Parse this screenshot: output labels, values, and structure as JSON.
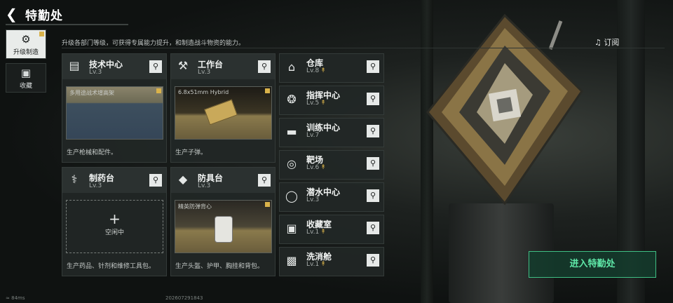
{
  "header": {
    "back_icon": "back-arrow-icon",
    "title": "特勤处"
  },
  "nav": [
    {
      "label": "升级制造",
      "icon": "upgrade-icon",
      "active": true
    },
    {
      "label": "收藏",
      "icon": "collection-icon",
      "active": false
    }
  ],
  "description": "升级各部门等级，可获得专属能力提升，和制造战斗物资的能力。",
  "large_cards": [
    {
      "name": "技术中心",
      "level": "Lv.3",
      "pic_caption": "多用途战术增高架",
      "footer": "生产枪械和配件。"
    },
    {
      "name": "工作台",
      "level": "Lv.3",
      "pic_caption": "6.8x51mm Hybrid",
      "footer": "生产子弹。"
    },
    {
      "name": "制药台",
      "level": "Lv.3",
      "idle_label": "空闲中",
      "footer": "生产药品、针剂和维修工具包。"
    },
    {
      "name": "防具台",
      "level": "Lv.3",
      "pic_caption": "精英防弹背心",
      "footer": "生产头盔、护甲、胸挂和背包。"
    }
  ],
  "small_cards": [
    {
      "name": "仓库",
      "level": "Lv.8",
      "upgrade": true
    },
    {
      "name": "指挥中心",
      "level": "Lv.5",
      "upgrade": true
    },
    {
      "name": "训练中心",
      "level": "Lv.7",
      "upgrade": false
    },
    {
      "name": "靶场",
      "level": "Lv.6",
      "upgrade": true
    },
    {
      "name": "潜水中心",
      "level": "Lv.3",
      "upgrade": false
    },
    {
      "name": "收藏室",
      "level": "Lv.1",
      "upgrade": true
    },
    {
      "name": "洗消舱",
      "level": "Lv.1",
      "upgrade": true
    }
  ],
  "subscribe_label": "订阅",
  "enter_button": "进入特勤处",
  "status": {
    "ping": "84ms",
    "id": "202607291843"
  },
  "colors": {
    "accent_green": "#3fbf84",
    "upgrade_gold": "#d9b24a"
  }
}
